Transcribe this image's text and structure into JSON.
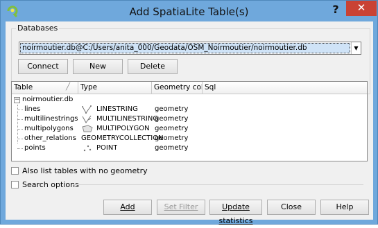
{
  "window": {
    "title": "Add SpatiaLite Table(s)",
    "help_label": "?",
    "close_label": "✕"
  },
  "databases": {
    "legend": "Databases",
    "selected": "noirmoutier.db@C:/Users/anita_000/Geodata/OSM_Noirmoutier/noirmoutier.db",
    "connect_label": "Connect",
    "new_label": "New",
    "delete_label": "Delete"
  },
  "table": {
    "headers": [
      "Table",
      "Type",
      "Geometry colum",
      "Sql"
    ],
    "root": "noirmoutier.db",
    "rows": [
      {
        "name": "lines",
        "icon": "linestring-icon",
        "type": "LINESTRING",
        "geometry": "geometry"
      },
      {
        "name": "multilinestrings",
        "icon": "multilinestring-icon",
        "type": "MULTILINESTRING",
        "geometry": "geometry"
      },
      {
        "name": "multipolygons",
        "icon": "multipolygon-icon",
        "type": "MULTIPOLYGON",
        "geometry": "geometry"
      },
      {
        "name": "other_relations",
        "icon": "",
        "type": "GEOMETRYCOLLECTION",
        "geometry": "geometry"
      },
      {
        "name": "points",
        "icon": "point-icon",
        "type": "POINT",
        "geometry": "geometry"
      }
    ]
  },
  "options": {
    "no_geometry_label": "Also list tables with no geometry",
    "search_options_label": "Search options"
  },
  "buttons": {
    "add_label": "Add",
    "set_filter_label": "Set Filter",
    "update_statistics_label": "Update statistics",
    "close_label": "Close",
    "help_label": "Help"
  }
}
